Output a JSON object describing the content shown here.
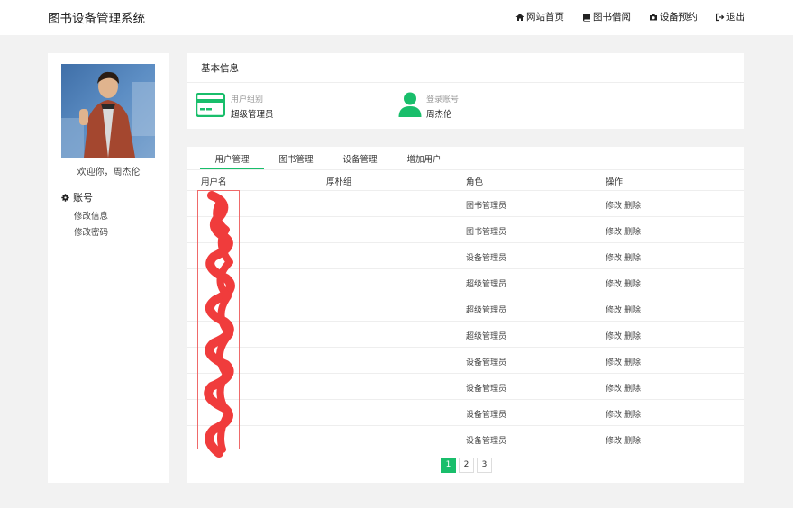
{
  "header": {
    "brand": "图书设备管理系统",
    "nav": [
      {
        "label": "网站首页",
        "icon": "home-icon"
      },
      {
        "label": "图书借阅",
        "icon": "book-icon"
      },
      {
        "label": "设备预约",
        "icon": "camera-icon"
      },
      {
        "label": "退出",
        "icon": "signout-icon"
      }
    ]
  },
  "sidebar": {
    "welcome": "欢迎你，周杰伦",
    "section_title": "账号",
    "links": [
      "修改信息",
      "修改密码"
    ]
  },
  "info": {
    "title": "基本信息",
    "group_label": "用户组别",
    "group_value": "超级管理员",
    "account_label": "登录账号",
    "account_value": "周杰伦",
    "accent_color": "#19be6b"
  },
  "tabs": [
    {
      "label": "用户管理",
      "active": true
    },
    {
      "label": "图书管理",
      "active": false
    },
    {
      "label": "设备管理",
      "active": false
    },
    {
      "label": "增加用户",
      "active": false
    }
  ],
  "table": {
    "columns": [
      "用户名",
      "厚朴组",
      "角色",
      "操作"
    ],
    "edit_label": "修改",
    "delete_label": "删除",
    "rows": [
      {
        "role": "图书管理员"
      },
      {
        "role": "图书管理员"
      },
      {
        "role": "设备管理员"
      },
      {
        "role": "超级管理员"
      },
      {
        "role": "超级管理员"
      },
      {
        "role": "超级管理员"
      },
      {
        "role": "设备管理员"
      },
      {
        "role": "设备管理员"
      },
      {
        "role": "设备管理员"
      },
      {
        "role": "设备管理员"
      }
    ]
  },
  "pagination": {
    "pages": [
      "1",
      "2",
      "3"
    ],
    "current": "1"
  }
}
